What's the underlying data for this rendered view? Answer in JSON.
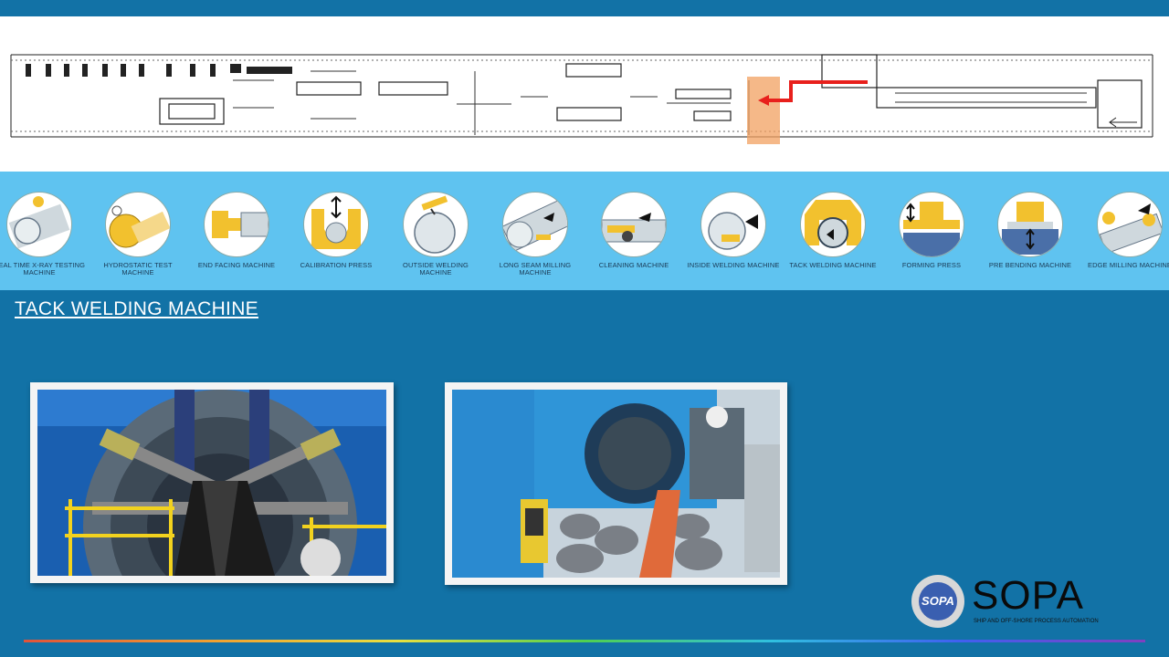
{
  "machines": [
    {
      "label": "REAL TIME X-RAY TESTING MACHINE",
      "icon": "xray-machine-icon"
    },
    {
      "label": "HYDROSTATIC TEST MACHINE",
      "icon": "hydrostatic-test-icon"
    },
    {
      "label": "END FACING MACHINE",
      "icon": "end-facing-icon"
    },
    {
      "label": "CALIBRATION PRESS",
      "icon": "calibration-press-icon"
    },
    {
      "label": "OUTSIDE WELDING MACHINE",
      "icon": "outside-welding-icon"
    },
    {
      "label": "LONG SEAM MILLING MACHINE",
      "icon": "long-seam-milling-icon"
    },
    {
      "label": "CLEANING MACHINE",
      "icon": "cleaning-machine-icon"
    },
    {
      "label": "INSIDE WELDING MACHINE",
      "icon": "inside-welding-icon"
    },
    {
      "label": "TACK WELDING MACHINE",
      "icon": "tack-welding-icon"
    },
    {
      "label": "FORMING PRESS",
      "icon": "forming-press-icon"
    },
    {
      "label": "PRE BENDING MACHINE",
      "icon": "pre-bending-icon"
    },
    {
      "label": "EDGE MILLING MACHINE",
      "icon": "edge-milling-icon"
    }
  ],
  "page_title": "TACK WELDING MACHINE",
  "logo": {
    "badge": "SOPA",
    "name": "SOPA",
    "tagline": "SHIP AND OFF-SHORE PROCESS AUTOMATION"
  },
  "colors": {
    "background": "#1272a6",
    "strip": "#5fc3f0",
    "accent_yellow": "#f2c12e",
    "highlight_red": "#e8201c",
    "highlight_orange": "#f2a060"
  }
}
